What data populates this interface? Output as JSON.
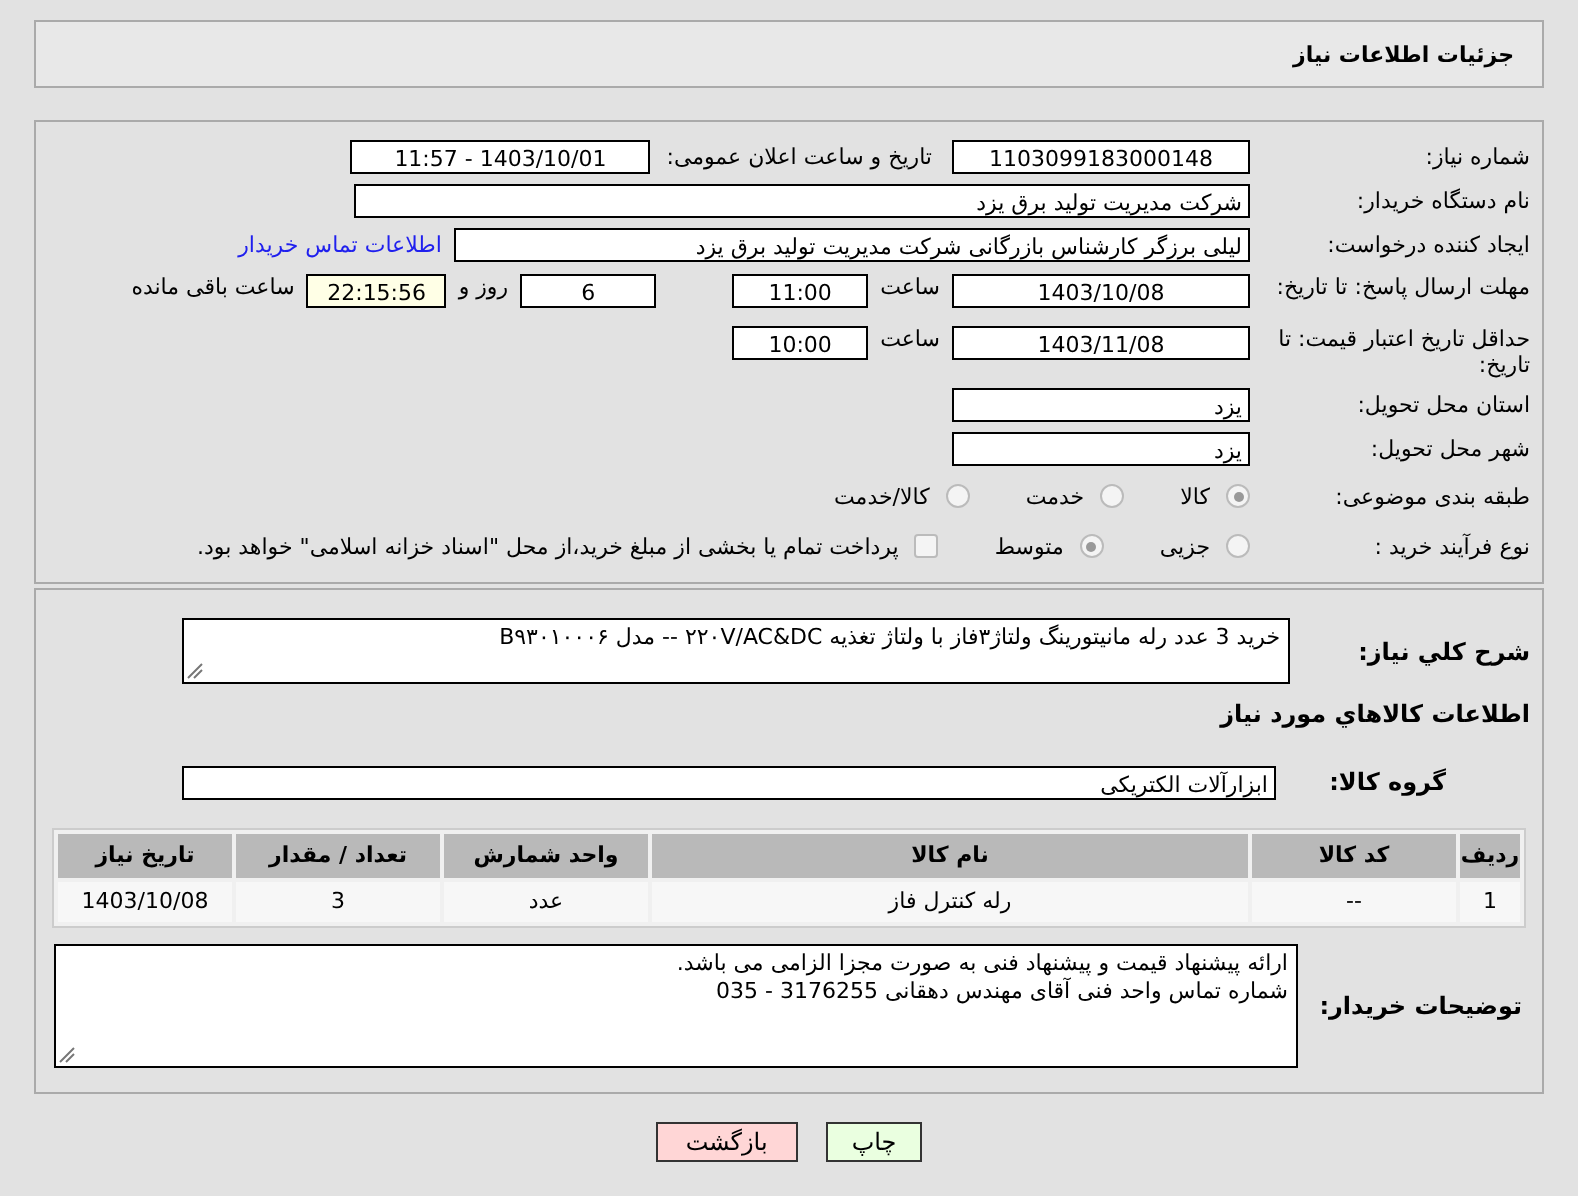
{
  "title": "جزئیات اطلاعات نیاز",
  "need_number": {
    "label": "شماره نیاز:",
    "value": "1103099183000148"
  },
  "announce": {
    "label": "تاریخ و ساعت اعلان عمومی:",
    "value": "1403/10/01 - 11:57"
  },
  "buyer_org": {
    "label": "نام دستگاه خریدار:",
    "value": "شرکت مدیریت تولید برق یزد"
  },
  "requester": {
    "label": "ایجاد کننده درخواست:",
    "value": "لیلی برزگر کارشناس بازرگانی شرکت مدیریت تولید برق یزد",
    "link": "اطلاعات تماس خریدار"
  },
  "response_deadline": {
    "label": "مهلت ارسال پاسخ: تا تاریخ:",
    "date": "1403/10/08",
    "time_label": "ساعت",
    "time": "11:00",
    "days": "6",
    "days_label": "روز و",
    "remaining": "22:15:56",
    "remaining_label": "ساعت باقی مانده"
  },
  "price_validity": {
    "label": "حداقل تاریخ اعتبار قیمت: تا تاریخ:",
    "date": "1403/11/08",
    "time_label": "ساعت",
    "time": "10:00"
  },
  "province": {
    "label": "استان محل تحویل:",
    "value": "یزد"
  },
  "city": {
    "label": "شهر محل تحویل:",
    "value": "یزد"
  },
  "category": {
    "label": "طبقه بندی موضوعی:",
    "options": [
      {
        "label": "کالا",
        "selected": true
      },
      {
        "label": "خدمت",
        "selected": false
      },
      {
        "label": "کالا/خدمت",
        "selected": false
      }
    ]
  },
  "process": {
    "label": "نوع فرآیند خرید :",
    "options": [
      {
        "label": "جزیی",
        "selected": false
      },
      {
        "label": "متوسط",
        "selected": true
      }
    ],
    "payment": {
      "checked": false,
      "text": "پرداخت تمام یا بخشی از مبلغ خرید،از محل \"اسناد خزانه اسلامی\" خواهد بود."
    }
  },
  "description": {
    "label": "شرح کلي نياز:",
    "value": "خرید 3 عدد رله مانیتورینگ ولتاژ۳فاز با ولتاژ تغذیه ۲۲۰V/AC&DC -- مدل B۹۳۰۱۰۰۰۶"
  },
  "items_heading": "اطلاعات کالاهاي مورد نياز",
  "goods_group": {
    "label": "گروه کالا:",
    "value": "ابزارآلات الکتریکی"
  },
  "table": {
    "columns": [
      "ردیف",
      "کد کالا",
      "نام کالا",
      "واحد شمارش",
      "تعداد / مقدار",
      "تاریخ نیاز"
    ],
    "rows": [
      [
        "1",
        "--",
        "رله کنترل فاز",
        "عدد",
        "3",
        "1403/10/08"
      ]
    ]
  },
  "buyer_notes": {
    "label": "توضیحات خریدار:",
    "value": "ارائه پیشنهاد قیمت و پیشنهاد فنی به صورت مجزا الزامی می باشد.\nشماره تماس واحد فنی آقای مهندس دهقانی 3176255 - 035"
  },
  "buttons": [
    {
      "label": "چاپ",
      "kind": "print"
    },
    {
      "label": "بازگشت",
      "kind": "back"
    }
  ]
}
